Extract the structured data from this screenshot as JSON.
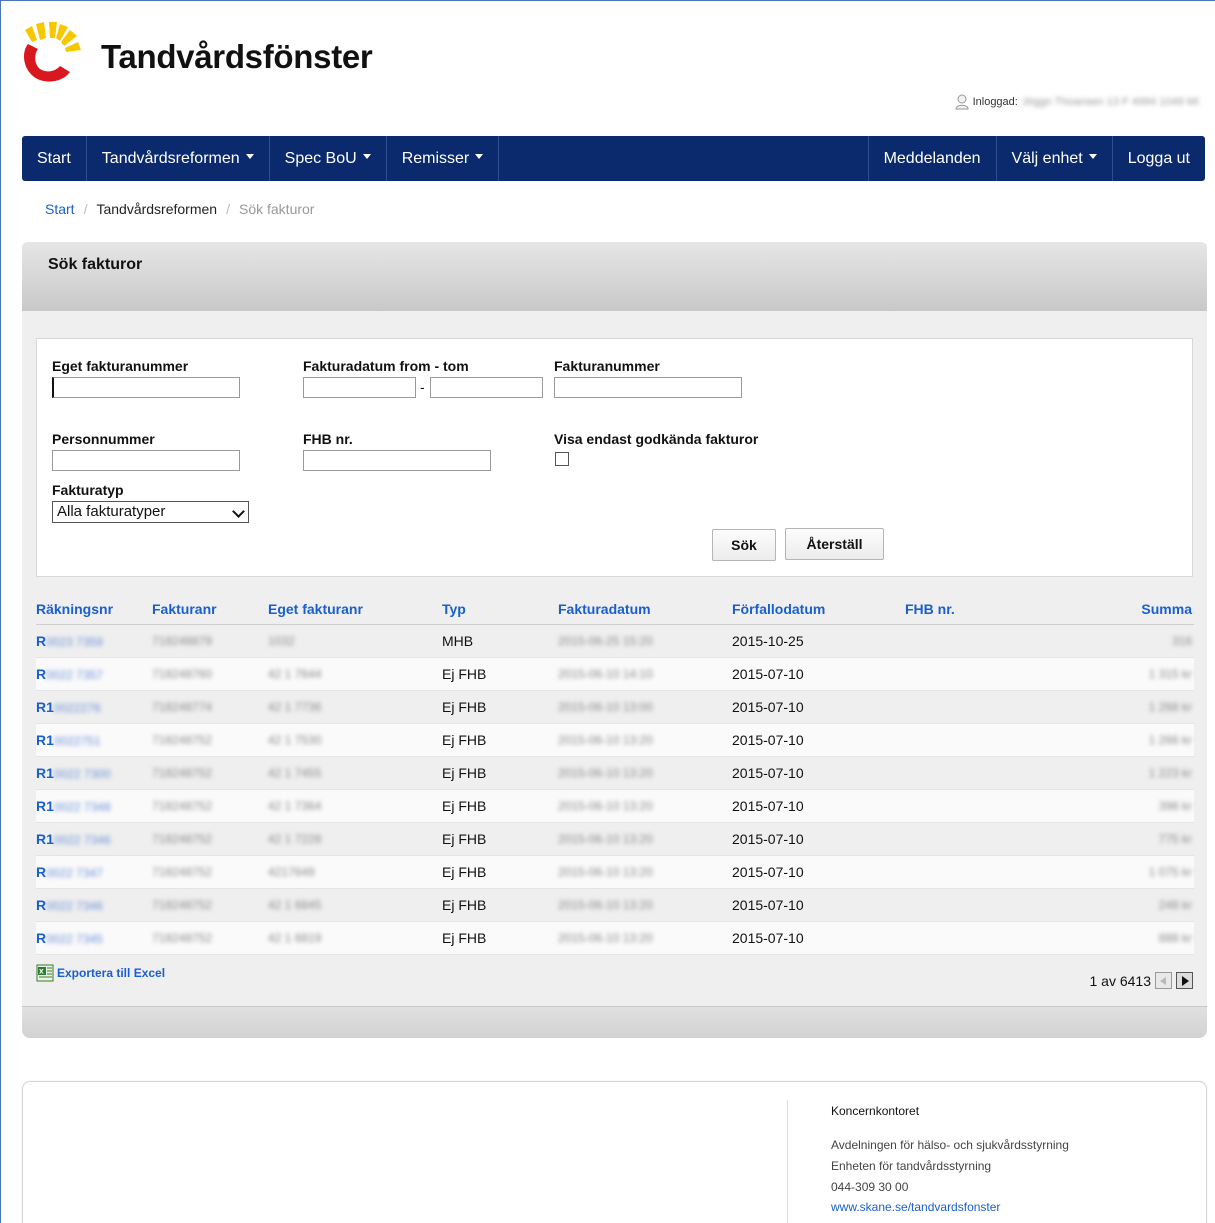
{
  "app": {
    "title": "Tandvårdsfönster",
    "login_label": "Inloggad:",
    "login_user": "Jöggn Thoansen 13 F 4994 1049 MI"
  },
  "nav": {
    "start": "Start",
    "tandvardsreformen": "Tandvårdsreformen",
    "spec_bou": "Spec BoU",
    "remisser": "Remisser",
    "meddelanden": "Meddelanden",
    "valj_enhet": "Välj enhet",
    "logga_ut": "Logga ut"
  },
  "breadcrumb": {
    "start": "Start",
    "section": "Tandvårdsreformen",
    "current": "Sök fakturor"
  },
  "panel": {
    "title": "Sök fakturor"
  },
  "form": {
    "eget_fakturanummer_label": "Eget fakturanummer",
    "eget_fakturanummer_value": "",
    "fakturadatum_label": "Fakturadatum from - tom",
    "fakturadatum_from": "",
    "fakturadatum_tom": "",
    "dash": "-",
    "fakturanummer_label": "Fakturanummer",
    "fakturanummer_value": "",
    "personnummer_label": "Personnummer",
    "personnummer_value": "",
    "fhb_label": "FHB nr.",
    "fhb_value": "",
    "visa_label": "Visa endast godkända fakturor",
    "visa_checked": false,
    "fakturatyp_label": "Fakturatyp",
    "fakturatyp_selected": "Alla fakturatyper",
    "sok_button": "Sök",
    "aterstall_button": "Återställ"
  },
  "table": {
    "columns": [
      "Räkningsnr",
      "Fakturanr",
      "Eget fakturanr",
      "Typ",
      "Fakturadatum",
      "Förfallodatum",
      "FHB nr.",
      "Summa"
    ],
    "rows": [
      {
        "rakningsnr_prefix": "R",
        "rakningsnr_rest": "0023 7359",
        "fakturanr": "718248879",
        "eget": "1032",
        "typ": "MHB",
        "fakturadatum": "2015-06-25 15:20",
        "forfallodatum": "2015-10-25",
        "fhb": "",
        "summa": "316"
      },
      {
        "rakningsnr_prefix": "R",
        "rakningsnr_rest": "0022 7357",
        "fakturanr": "718248760",
        "eget": "42 1 7644",
        "typ": "Ej FHB",
        "fakturadatum": "2015-06-10 14:10",
        "forfallodatum": "2015-07-10",
        "fhb": "",
        "summa": "1 315 kr"
      },
      {
        "rakningsnr_prefix": "R1",
        "rakningsnr_rest": "0022276",
        "fakturanr": "718248774",
        "eget": "42 1 7736",
        "typ": "Ej FHB",
        "fakturadatum": "2015-06-10 13:00",
        "forfallodatum": "2015-07-10",
        "fhb": "",
        "summa": "1 268 kr"
      },
      {
        "rakningsnr_prefix": "R1",
        "rakningsnr_rest": "0022751",
        "fakturanr": "718248752",
        "eget": "42 1 7530",
        "typ": "Ej FHB",
        "fakturadatum": "2015-06-10 13:20",
        "forfallodatum": "2015-07-10",
        "fhb": "",
        "summa": "1 266 kr"
      },
      {
        "rakningsnr_prefix": "R1",
        "rakningsnr_rest": "0022 7300",
        "fakturanr": "718248752",
        "eget": "42 1 7455",
        "typ": "Ej FHB",
        "fakturadatum": "2015-06-10 13:20",
        "forfallodatum": "2015-07-10",
        "fhb": "",
        "summa": "1 223 kr"
      },
      {
        "rakningsnr_prefix": "R1",
        "rakningsnr_rest": "0022 7348",
        "fakturanr": "718248752",
        "eget": "42 1 7364",
        "typ": "Ej FHB",
        "fakturadatum": "2015-06-10 13:20",
        "forfallodatum": "2015-07-10",
        "fhb": "",
        "summa": "398 kr"
      },
      {
        "rakningsnr_prefix": "R1",
        "rakningsnr_rest": "0022 7346",
        "fakturanr": "718248752",
        "eget": "42 1 7228",
        "typ": "Ej FHB",
        "fakturadatum": "2015-06-10 13:20",
        "forfallodatum": "2015-07-10",
        "fhb": "",
        "summa": "775 kr"
      },
      {
        "rakningsnr_prefix": "R",
        "rakningsnr_rest": "0022 7347",
        "fakturanr": "718248752",
        "eget": "4217649",
        "typ": "Ej FHB",
        "fakturadatum": "2015-06-10 13:20",
        "forfallodatum": "2015-07-10",
        "fhb": "",
        "summa": "1 075 kr"
      },
      {
        "rakningsnr_prefix": "R",
        "rakningsnr_rest": "0022 7346",
        "fakturanr": "718248752",
        "eget": "42 1 6845",
        "typ": "Ej FHB",
        "fakturadatum": "2015-06-10 13:20",
        "forfallodatum": "2015-07-10",
        "fhb": "",
        "summa": "248 kr"
      },
      {
        "rakningsnr_prefix": "R",
        "rakningsnr_rest": "0022 7345",
        "fakturanr": "718248752",
        "eget": "42 1 6819",
        "typ": "Ej FHB",
        "fakturadatum": "2015-06-10 13:20",
        "forfallodatum": "2015-07-10",
        "fhb": "",
        "summa": "888 kr"
      }
    ]
  },
  "export_label": "Exportera till Excel",
  "pager": {
    "text": "1 av 6413"
  },
  "footer": {
    "title": "Koncernkontoret",
    "line1": "Avdelningen för hälso- och sjukvårdsstyrning",
    "line2": "Enheten för tandvårdsstyrning",
    "phone": "044-309 30 00",
    "link": "www.skane.se/tandvardsfonster"
  },
  "colors": {
    "navbar": "#0b2a6e",
    "link": "#1a5fcf",
    "logo_yellow": "#f7c700",
    "logo_red": "#d8171f"
  }
}
